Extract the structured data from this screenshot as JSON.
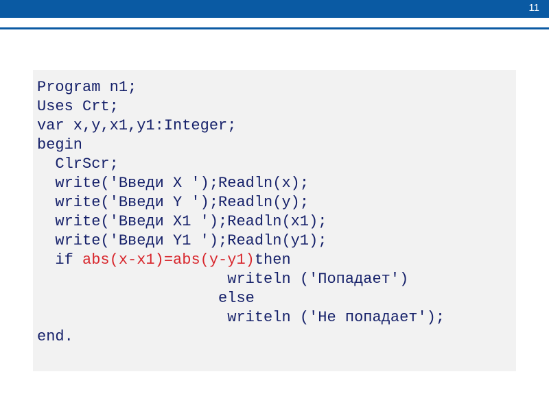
{
  "slide": {
    "page_number": "11"
  },
  "code": {
    "l1": "Program n1;",
    "l2": "Uses Crt;",
    "l3": "var x,y,x1,y1:Integer;",
    "l4": "begin",
    "l5": "  ClrScr;",
    "l6": "  write('Введи X ');Readln(x);",
    "l7": "  write('Введи Y ');Readln(y);",
    "l8": "  write('Введи X1 ');Readln(x1);",
    "l9": "  write('Введи Y1 ');Readln(y1);",
    "l10a": "  if ",
    "l10b": "abs(x-x1)=abs(y-y1)",
    "l10c": "then",
    "l11": "                     writeln ('Попадает')",
    "l12": "                    else ",
    "l13": "                     writeln ('Не попадает');",
    "l14": "end."
  }
}
